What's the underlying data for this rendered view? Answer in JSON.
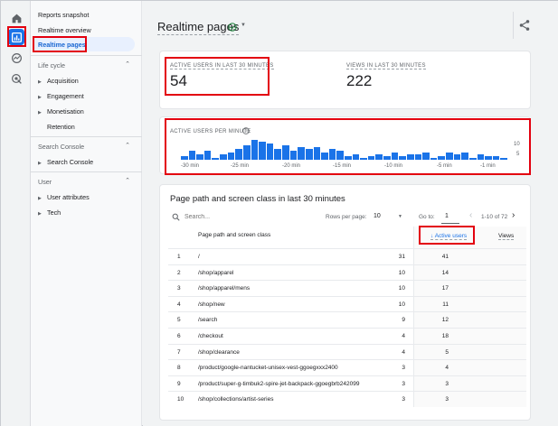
{
  "rail": {
    "items": [
      "home-icon",
      "reports-icon",
      "explore-icon",
      "advertising-icon"
    ]
  },
  "nav": {
    "heading": "Reports snapshot",
    "items": [
      {
        "label": "Realtime overview"
      },
      {
        "label": "Realtime pages",
        "active": true
      }
    ],
    "sections": [
      {
        "label": "Life cycle",
        "children": [
          "Acquisition",
          "Engagement",
          "Monetisation"
        ],
        "extra": "Retention"
      },
      {
        "label": "Search Console",
        "children": [
          "Search Console"
        ]
      },
      {
        "label": "User",
        "children": [
          "User attributes",
          "Tech"
        ]
      }
    ]
  },
  "header": {
    "title": "Realtime pages"
  },
  "metrics": {
    "active_label": "ACTIVE USERS IN LAST 30 MINUTES",
    "active_value": "54",
    "views_label": "VIEWS IN LAST 30 MINUTES",
    "views_value": "222"
  },
  "chart_data": {
    "type": "bar",
    "title": "ACTIVE USERS PER MINUTE",
    "x_ticks": [
      "-30 min",
      "-25 min",
      "-20 min",
      "-15 min",
      "-10 min",
      "-5 min",
      "-1 min"
    ],
    "y_ticks": [
      "10",
      "5"
    ],
    "ylim": [
      0,
      11
    ],
    "values": [
      2,
      5,
      3,
      5,
      1,
      3,
      4,
      6,
      8,
      11,
      10,
      9,
      6,
      8,
      5,
      7,
      6,
      7,
      4,
      6,
      5,
      2,
      3,
      1,
      2,
      3,
      2,
      4,
      2,
      3,
      3,
      4,
      1,
      2,
      4,
      3,
      4,
      1,
      3,
      2,
      2,
      1
    ]
  },
  "table": {
    "title": "Page path and screen class in last 30 minutes",
    "search_placeholder": "Search...",
    "rows_per_page_label": "Rows per page:",
    "rows_per_page": "10",
    "goto_label": "Go to:",
    "goto_value": "1",
    "range": "1-10 of 72",
    "columns": [
      "Page path and screen class",
      "Active users",
      "Views"
    ],
    "rows": [
      {
        "n": "1",
        "path": "/",
        "users": "31",
        "views": "41"
      },
      {
        "n": "2",
        "path": "/shop/apparel",
        "users": "10",
        "views": "14"
      },
      {
        "n": "3",
        "path": "/shop/apparel/mens",
        "users": "10",
        "views": "17"
      },
      {
        "n": "4",
        "path": "/shop/new",
        "users": "10",
        "views": "11"
      },
      {
        "n": "5",
        "path": "/search",
        "users": "9",
        "views": "12"
      },
      {
        "n": "6",
        "path": "/checkout",
        "users": "4",
        "views": "18"
      },
      {
        "n": "7",
        "path": "/shop/clearance",
        "users": "4",
        "views": "5"
      },
      {
        "n": "8",
        "path": "/product/google-nantucket-unisex-vest-ggoegxxx2400",
        "users": "3",
        "views": "4"
      },
      {
        "n": "9",
        "path": "/product/super-g-timbuk2-spire-jet-backpack-ggoegbrb242099",
        "users": "3",
        "views": "3"
      },
      {
        "n": "10",
        "path": "/shop/collections/artist-series",
        "users": "3",
        "views": "3"
      }
    ]
  },
  "colors": {
    "accent": "#1a73e8",
    "highlight": "#e3000f"
  }
}
